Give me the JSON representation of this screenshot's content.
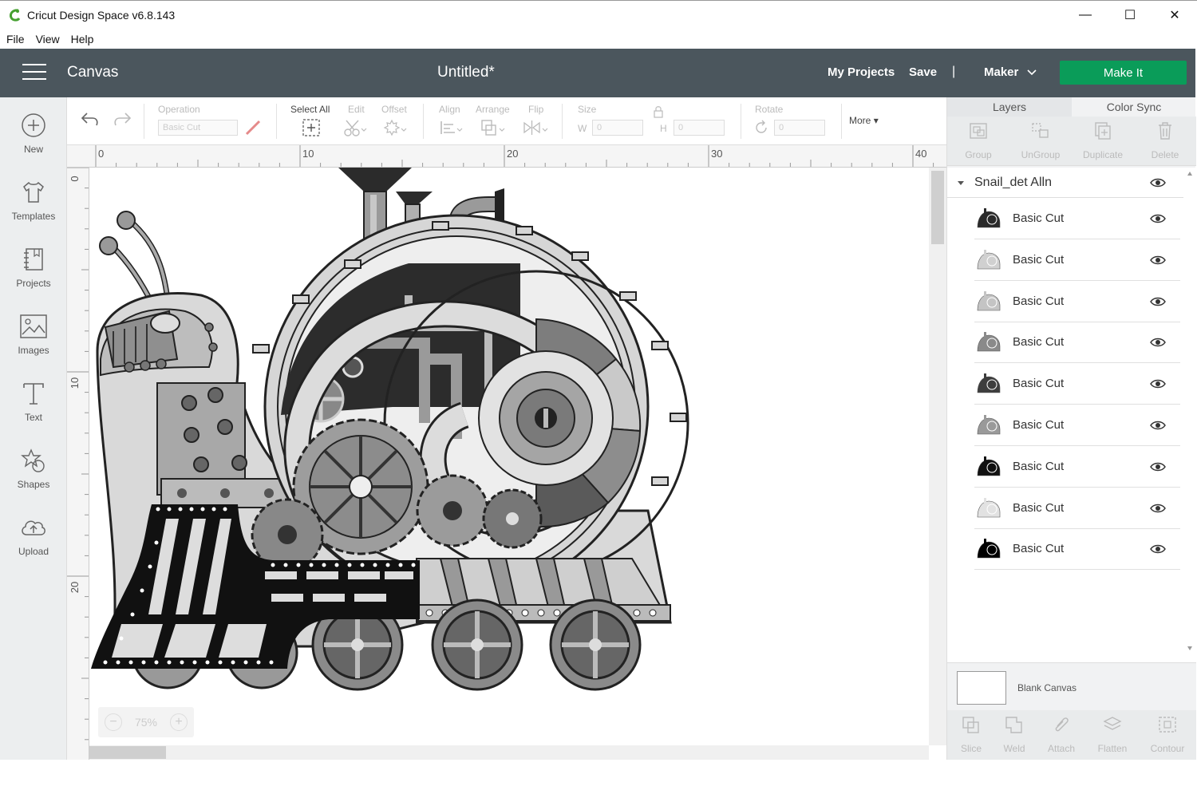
{
  "window": {
    "title": "Cricut Design Space  v6.8.143",
    "buttons": [
      "—",
      "☐",
      "✕"
    ]
  },
  "menu": [
    "File",
    "View",
    "Help"
  ],
  "header": {
    "section": "Canvas",
    "document_title": "Untitled*",
    "my_projects": "My Projects",
    "save": "Save",
    "separator": "|",
    "machine": "Maker",
    "make_it": "Make It"
  },
  "leftnav": [
    {
      "label": "New",
      "icon": "plus-circle-icon"
    },
    {
      "label": "Templates",
      "icon": "shirt-icon"
    },
    {
      "label": "Projects",
      "icon": "notebook-icon"
    },
    {
      "label": "Images",
      "icon": "image-icon"
    },
    {
      "label": "Text",
      "icon": "text-icon"
    },
    {
      "label": "Shapes",
      "icon": "shapes-icon"
    },
    {
      "label": "Upload",
      "icon": "cloud-upload-icon"
    }
  ],
  "toolbar": {
    "operation_label": "Operation",
    "operation_value": "Basic Cut",
    "select_all": "Select All",
    "edit": "Edit",
    "offset": "Offset",
    "align": "Align",
    "arrange": "Arrange",
    "flip": "Flip",
    "size": "Size",
    "w": "W",
    "w_value": "0",
    "h": "H",
    "h_value": "0",
    "rotate": "Rotate",
    "rotate_value": "0",
    "more": "More"
  },
  "ruler": {
    "top": [
      "0",
      "10",
      "20",
      "30",
      "40"
    ],
    "left": [
      "0",
      "10",
      "20"
    ]
  },
  "zoom": {
    "minus": "−",
    "value": "75%",
    "plus": "+"
  },
  "panel": {
    "tabs": [
      "Layers",
      "Color Sync"
    ],
    "actions": [
      "Group",
      "UnGroup",
      "Duplicate",
      "Delete"
    ],
    "group_name": "Snail_det Alln",
    "layers": [
      {
        "name": "Basic Cut",
        "color": "#2a2a2a"
      },
      {
        "name": "Basic Cut",
        "color": "#d0d0d0"
      },
      {
        "name": "Basic Cut",
        "color": "#c4c4c4"
      },
      {
        "name": "Basic Cut",
        "color": "#8a8a8a"
      },
      {
        "name": "Basic Cut",
        "color": "#3d3d3d"
      },
      {
        "name": "Basic Cut",
        "color": "#9a9a9a"
      },
      {
        "name": "Basic Cut",
        "color": "#111111"
      },
      {
        "name": "Basic Cut",
        "color": "#e2e2e2"
      },
      {
        "name": "Basic Cut",
        "color": "#000000"
      }
    ],
    "blank_canvas": "Blank Canvas",
    "bottom_actions": [
      "Slice",
      "Weld",
      "Attach",
      "Flatten",
      "Contour"
    ]
  },
  "colors": {
    "header_bg": "#4b565d",
    "make_it": "#0a9c59",
    "accent_logo": "#46a030"
  }
}
